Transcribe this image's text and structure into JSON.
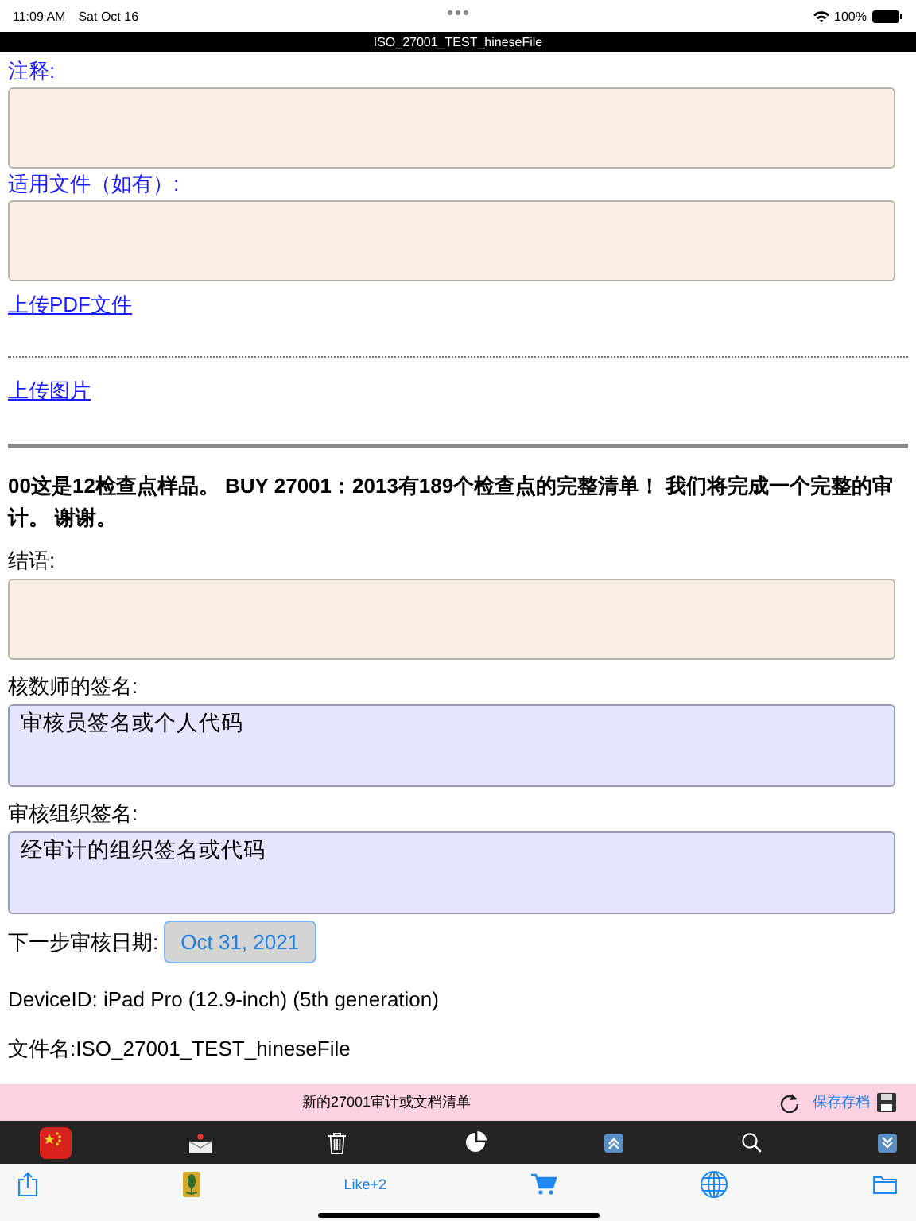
{
  "status_bar": {
    "time": "11:09 AM",
    "date": "Sat Oct 16",
    "battery": "100%"
  },
  "title_bar": {
    "title": "ISO_27001_TEST_hineseFile"
  },
  "form": {
    "notes_label": "注释:",
    "applicable_label": "适用文件（如有）:",
    "upload_pdf": "上传PDF文件",
    "upload_image": "上传图片",
    "notice": "00这是12检查点样品。 BUY 27001：2013有189个检查点的完整清单！ 我们将完成一个完整的审计。 谢谢。",
    "fields": [
      {
        "label": "结语:",
        "kind": "plain"
      },
      {
        "label": "核数师的签名:",
        "value": "审核员签名或个人代码",
        "kind": "signature"
      },
      {
        "label": "审核组织签名:",
        "value": "经审计的组织签名或代码",
        "kind": "signature"
      }
    ],
    "next_date_label": "下一步审核日期:",
    "next_date": "Oct 31, 2021",
    "device_id": "DeviceID: iPad Pro (12.9-inch) (5th generation)",
    "file_name": "文件名:ISO_27001_TEST_hineseFile"
  },
  "action_bar": {
    "title": "新的27001审计或文档清单",
    "save": "保存存档"
  },
  "bottom_bar": {
    "like": "Like+2"
  }
}
